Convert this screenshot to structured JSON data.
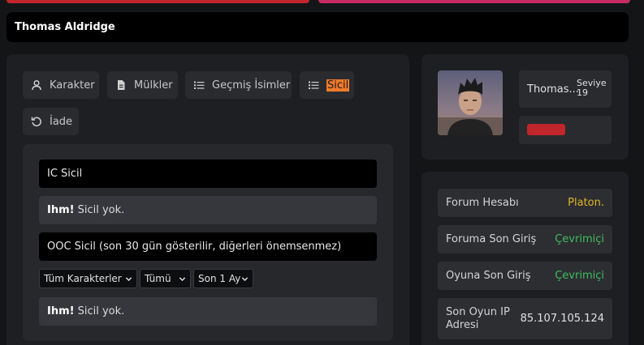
{
  "header": {
    "player_name": "Thomas Aldridge"
  },
  "tabs": [
    {
      "label": "Karakter",
      "icon": "user-icon"
    },
    {
      "label": "Mülkler",
      "icon": "document-icon"
    },
    {
      "label": "Geçmiş İsimler",
      "icon": "list-icon"
    },
    {
      "label": "Sicil",
      "icon": "list-icon",
      "active": true
    },
    {
      "label": "İade",
      "icon": "refresh-icon"
    }
  ],
  "record": {
    "ic_title": "IC Sicil",
    "ic_empty_prefix": "Ihm!",
    "ic_empty_text": "Sicil yok.",
    "ooc_title": "OOC Sicil (son 30 gün gösterilir, diğerleri önemsenmez)",
    "filters": {
      "character": "Tüm Karakterler",
      "type": "Tümü",
      "period": "Son 1 Ay"
    },
    "ooc_empty_prefix": "Ihm!",
    "ooc_empty_text": "Sicil yok."
  },
  "profile": {
    "short_name": "Thomas...",
    "level_label": "Seviye",
    "level_value": "19",
    "badge_color": "#c0262c"
  },
  "stats": [
    {
      "label": "Forum Hesabı",
      "value": "Platon.",
      "color": "#e2b51f"
    },
    {
      "label": "Foruma Son Giriş",
      "value": "Çevrimiçi",
      "color": "#3dbd5c"
    },
    {
      "label": "Oyuna Son Giriş",
      "value": "Çevrimiçi",
      "color": "#3dbd5c"
    },
    {
      "label": "Son Oyun IP Adresi",
      "value": "85.107.105.124",
      "color": "#e0e0e0"
    }
  ]
}
